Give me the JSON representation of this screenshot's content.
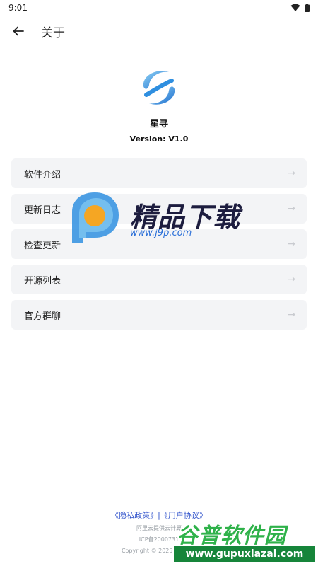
{
  "status": {
    "time": "9:01"
  },
  "appbar": {
    "title": "关于"
  },
  "app": {
    "name": "星寻",
    "version": "Version: V1.0"
  },
  "menu": {
    "items": [
      {
        "label": "软件介绍"
      },
      {
        "label": "更新日志"
      },
      {
        "label": "检查更新"
      },
      {
        "label": "开源列表"
      },
      {
        "label": "官方群聊"
      }
    ]
  },
  "footer": {
    "privacy": "《隐私政策》",
    "separator": "|",
    "terms": "《用户协议》",
    "line1": "阿里云提供云计算",
    "line2": "ICP备2000731",
    "copyright": "Copyright © 2025 星寻, All"
  },
  "watermarks": {
    "top": {
      "title": "精品下载",
      "url": "www.j9p.com"
    },
    "bottom": {
      "title": "谷普软件园",
      "url": "www.gupuxlazal.com"
    }
  },
  "colors": {
    "background": "#ffffff",
    "card": "#f3f4f6",
    "link": "#3355cc",
    "logo_blue": "#2f8fe0",
    "logo_light": "#7ec8f2"
  }
}
